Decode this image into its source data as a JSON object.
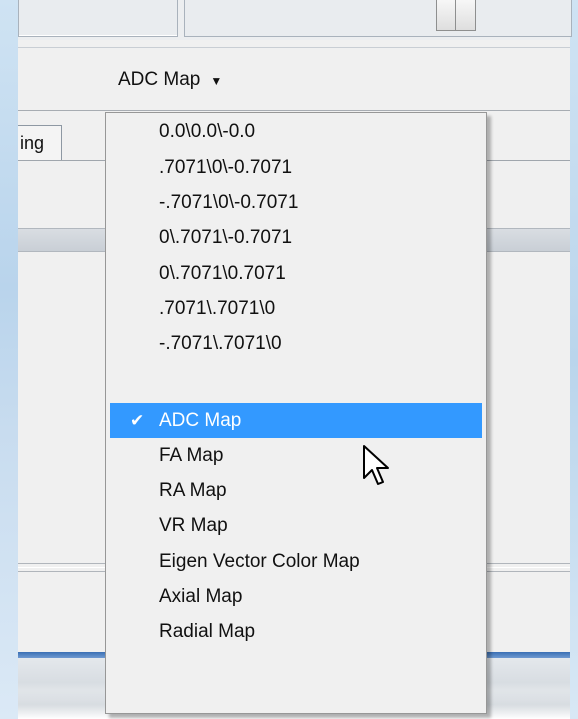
{
  "toolbar": {
    "dropdown_label": "ADC Map",
    "dropdown_caret_icon": "caret-down-icon"
  },
  "tab": {
    "label": "ing"
  },
  "menu": {
    "items": [
      {
        "label": "0.0\\0.0\\-0.0",
        "selected": false
      },
      {
        "label": ".7071\\0\\-0.7071",
        "selected": false
      },
      {
        "label": "-.7071\\0\\-0.7071",
        "selected": false
      },
      {
        "label": "0\\.7071\\-0.7071",
        "selected": false
      },
      {
        "label": "0\\.7071\\0.7071",
        "selected": false
      },
      {
        "label": ".7071\\.7071\\0",
        "selected": false
      },
      {
        "label": "-.7071\\.7071\\0",
        "selected": false
      },
      {
        "label": "ADC Map",
        "selected": true
      },
      {
        "label": "FA Map",
        "selected": false
      },
      {
        "label": "RA Map",
        "selected": false
      },
      {
        "label": "VR Map",
        "selected": false
      },
      {
        "label": "Eigen Vector Color Map",
        "selected": false
      },
      {
        "label": "Axial Map",
        "selected": false
      },
      {
        "label": "Radial Map",
        "selected": false
      }
    ],
    "check_icon": "checkmark-icon",
    "selected_color": "#3399ff"
  },
  "cursor": {
    "icon": "mouse-pointer-icon"
  }
}
